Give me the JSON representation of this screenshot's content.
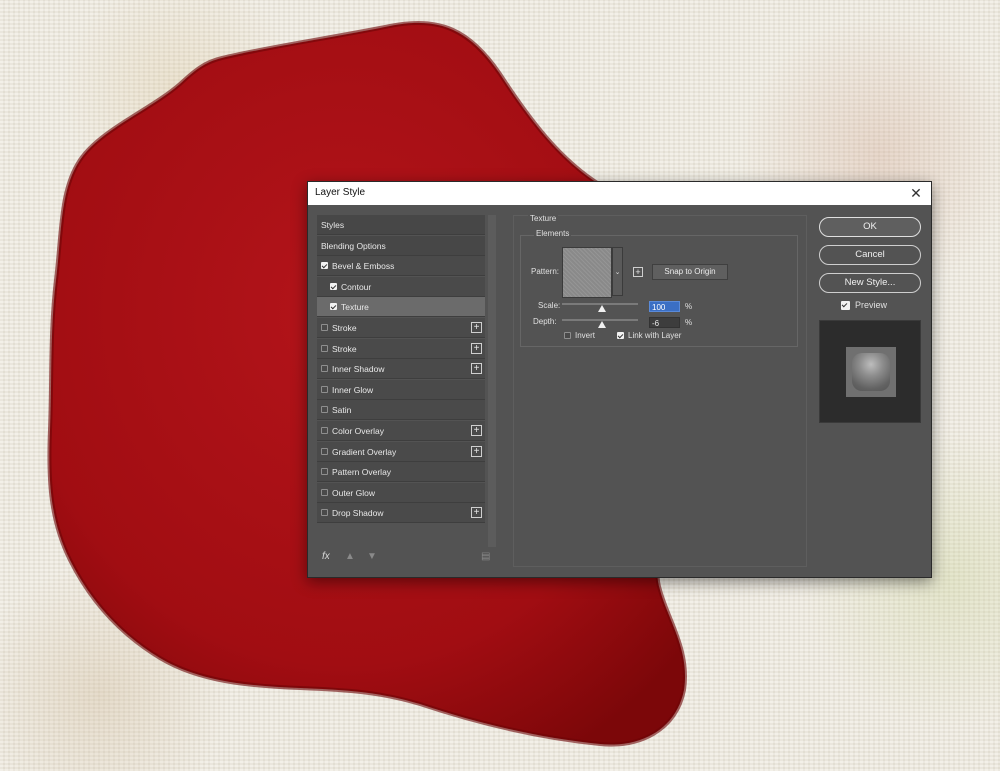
{
  "dialog": {
    "title": "Layer Style",
    "close_icon": "close-icon"
  },
  "style_list": {
    "items": [
      {
        "label": "Styles",
        "checkbox": false,
        "checked": false,
        "plus": false,
        "indent": false,
        "selected": false
      },
      {
        "label": "Blending Options",
        "checkbox": false,
        "checked": false,
        "plus": false,
        "indent": false,
        "selected": false
      },
      {
        "label": "Bevel & Emboss",
        "checkbox": true,
        "checked": true,
        "plus": false,
        "indent": false,
        "selected": false
      },
      {
        "label": "Contour",
        "checkbox": true,
        "checked": true,
        "plus": false,
        "indent": true,
        "selected": false
      },
      {
        "label": "Texture",
        "checkbox": true,
        "checked": true,
        "plus": false,
        "indent": true,
        "selected": true
      },
      {
        "label": "Stroke",
        "checkbox": true,
        "checked": false,
        "plus": true,
        "indent": false,
        "selected": false
      },
      {
        "label": "Stroke",
        "checkbox": true,
        "checked": false,
        "plus": true,
        "indent": false,
        "selected": false
      },
      {
        "label": "Inner Shadow",
        "checkbox": true,
        "checked": false,
        "plus": true,
        "indent": false,
        "selected": false
      },
      {
        "label": "Inner Glow",
        "checkbox": true,
        "checked": false,
        "plus": false,
        "indent": false,
        "selected": false
      },
      {
        "label": "Satin",
        "checkbox": true,
        "checked": false,
        "plus": false,
        "indent": false,
        "selected": false
      },
      {
        "label": "Color Overlay",
        "checkbox": true,
        "checked": false,
        "plus": true,
        "indent": false,
        "selected": false
      },
      {
        "label": "Gradient Overlay",
        "checkbox": true,
        "checked": false,
        "plus": true,
        "indent": false,
        "selected": false
      },
      {
        "label": "Pattern Overlay",
        "checkbox": true,
        "checked": false,
        "plus": false,
        "indent": false,
        "selected": false
      },
      {
        "label": "Outer Glow",
        "checkbox": true,
        "checked": false,
        "plus": false,
        "indent": false,
        "selected": false
      },
      {
        "label": "Drop Shadow",
        "checkbox": true,
        "checked": false,
        "plus": true,
        "indent": false,
        "selected": false
      }
    ],
    "plus_glyph": "+",
    "bottom_icons": {
      "fx": "fx",
      "move_up_icon": "arrow-up-icon",
      "move_down_icon": "arrow-down-icon",
      "delete_icon": "trash-icon"
    }
  },
  "texture": {
    "section_title": "Texture",
    "group_title": "Elements",
    "pattern_label": "Pattern:",
    "dropdown_glyph": "⌄",
    "new_preset_glyph": "+",
    "snap_to_origin": "Snap to Origin",
    "scale_label": "Scale:",
    "scale_value": "100",
    "scale_percent": 100,
    "depth_label": "Depth:",
    "depth_value": "-6",
    "depth_percent": -6,
    "percent_sign": "%",
    "invert_label": "Invert",
    "invert_checked": false,
    "link_label": "Link with Layer",
    "link_checked": true
  },
  "buttons": {
    "ok": "OK",
    "cancel": "Cancel",
    "new_style": "New Style...",
    "preview_label": "Preview",
    "preview_checked": true
  },
  "colors": {
    "dialog_bg": "#535353",
    "selected_item": "#6b6b6b",
    "wax_red": "#a50d11",
    "input_focus": "#3b6fc4"
  }
}
